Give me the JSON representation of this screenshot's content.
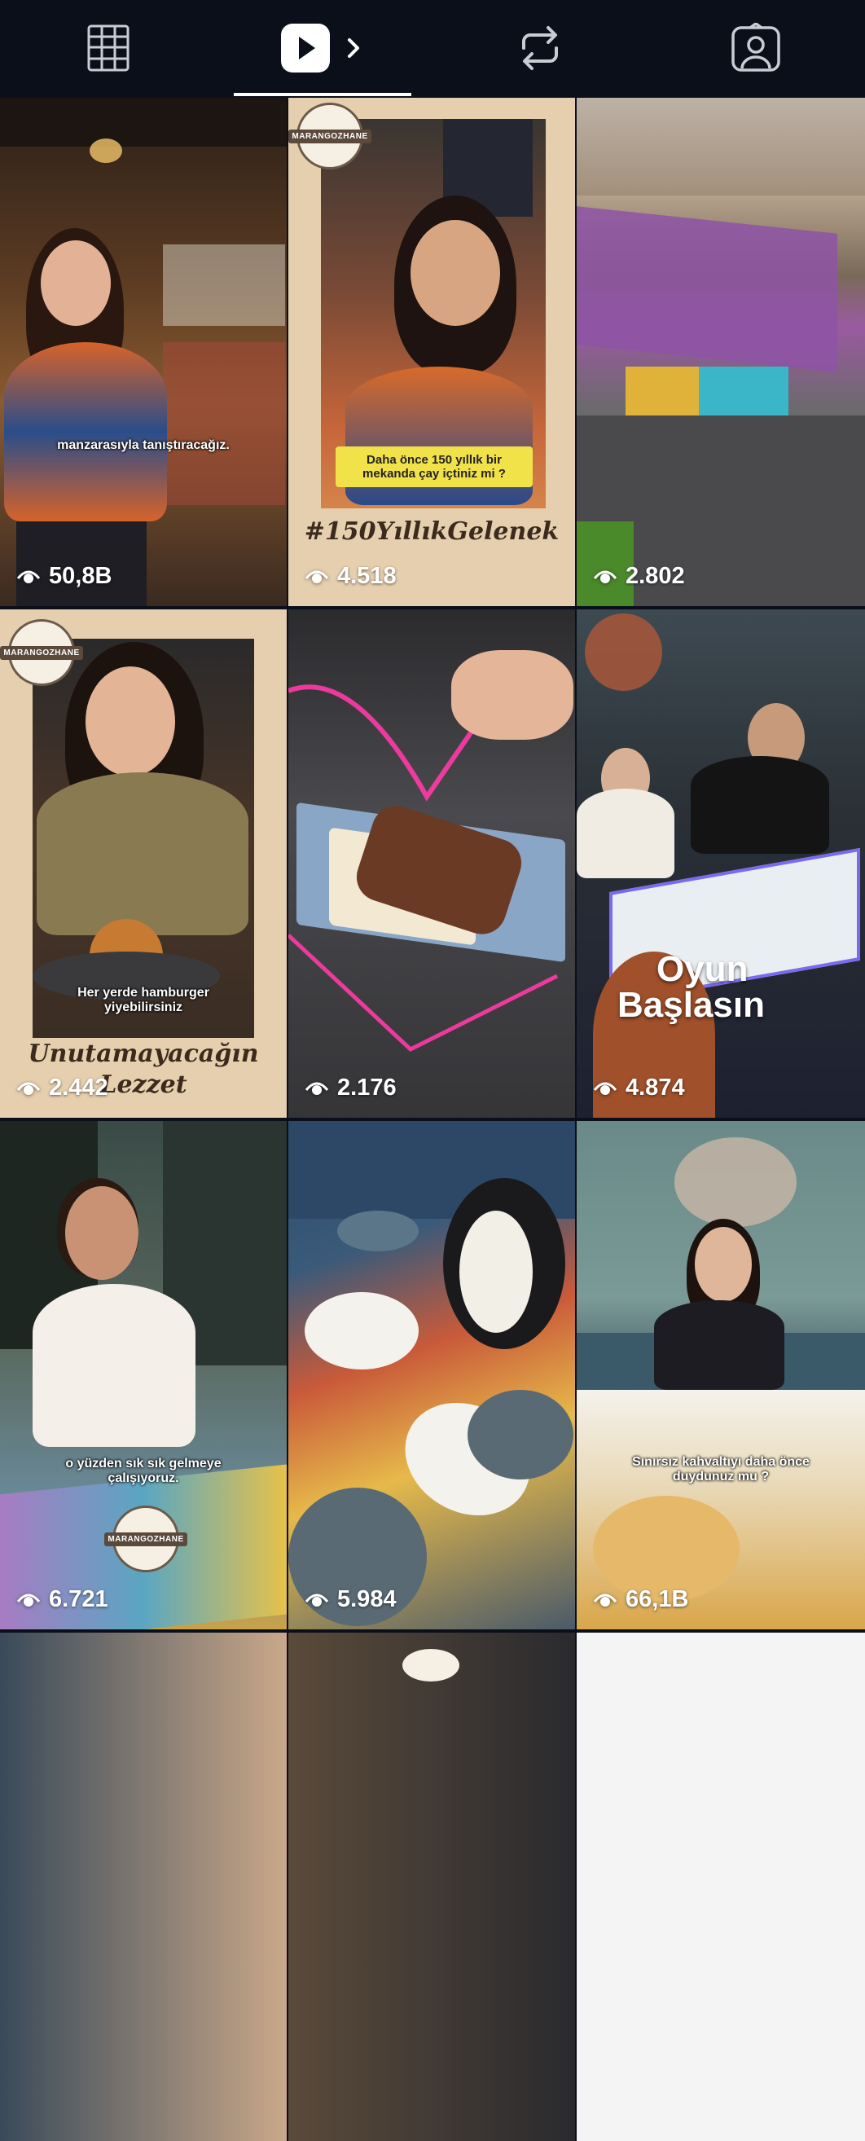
{
  "tabs": [
    {
      "name": "grid-tab"
    },
    {
      "name": "reels-tab"
    },
    {
      "name": "reposts-tab"
    },
    {
      "name": "tagged-tab"
    }
  ],
  "reels": [
    {
      "views": "50,8B",
      "caption": "manzarasıyla tanıştıracağız."
    },
    {
      "views": "4.518",
      "logo": "MARANGOZHANE",
      "caption": "Daha önce 150 yıllık bir mekanda çay içtiniz mi ?",
      "script": "#150YıllıkGelenek"
    },
    {
      "views": "2.802"
    },
    {
      "views": "2.442",
      "logo": "MARANGOZHANE",
      "caption": "Her yerde hamburger yiyebilirsiniz",
      "script_line1": "Unutamayacağın",
      "script_line2": "Lezzet"
    },
    {
      "views": "2.176"
    },
    {
      "views": "4.874",
      "title_line1": "Oyun",
      "title_line2": "Başlasın"
    },
    {
      "views": "6.721",
      "caption": "o yüzden sık sık gelmeye çalışıyoruz.",
      "logo": "MARANGOZHANE"
    },
    {
      "views": "5.984"
    },
    {
      "views": "66,1B",
      "caption": "Sınırsız kahvaltıyı daha önce duydunuz mu ?"
    }
  ],
  "partial_row": [
    {
      "name": "partial-reel-1"
    },
    {
      "name": "partial-reel-2"
    },
    {
      "name": "partial-reel-3"
    }
  ]
}
